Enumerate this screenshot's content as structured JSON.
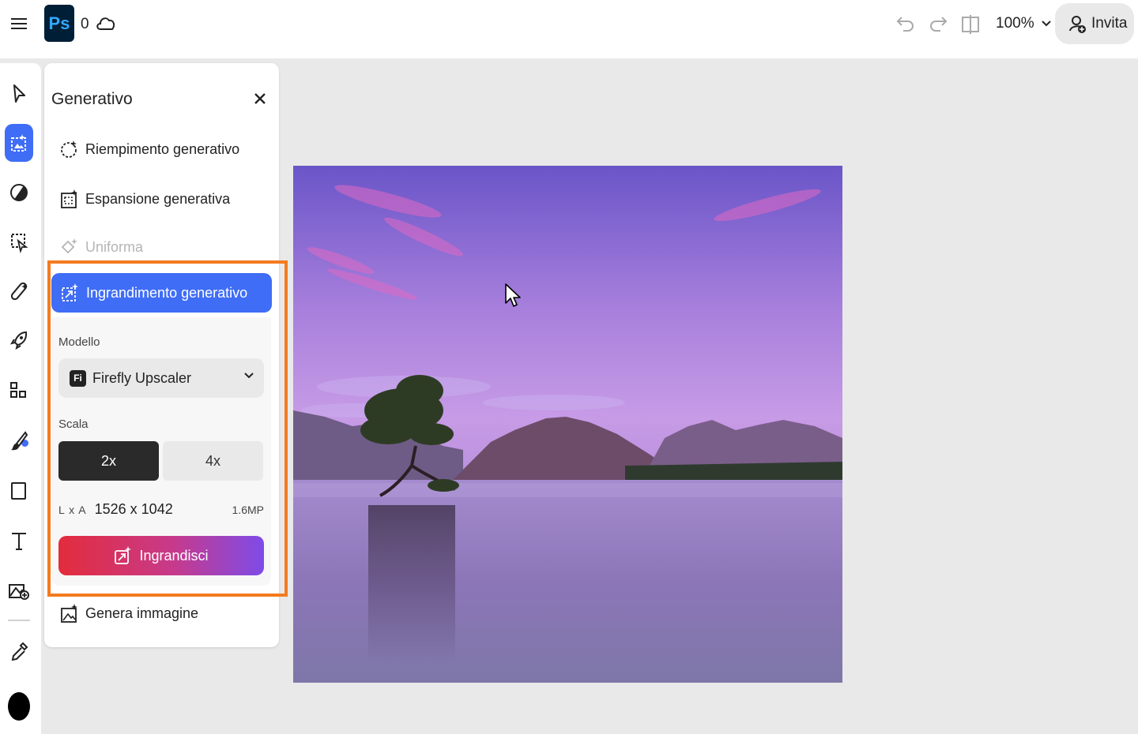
{
  "topbar": {
    "app": "Ps",
    "count": "0",
    "zoom": "100%",
    "invite_label": "Invita"
  },
  "panel": {
    "title": "Generativo",
    "items": [
      {
        "label": "Riempimento generativo",
        "icon": "generative-fill-icon"
      },
      {
        "label": "Espansione generativa",
        "icon": "generative-expand-icon"
      },
      {
        "label": "Uniforma",
        "icon": "harmonize-icon",
        "disabled": true
      },
      {
        "label": "Ingrandimento generativo",
        "icon": "generative-upscale-icon",
        "active": true
      },
      {
        "label": "Genera immagine",
        "icon": "generate-image-icon"
      }
    ],
    "model_label": "Modello",
    "model_badge": "Fi",
    "model_value": "Firefly Upscaler",
    "scale_label": "Scala",
    "scale_options": [
      "2x",
      "4x"
    ],
    "scale_selected": "2x",
    "dims_label": "L x A",
    "dims_value": "1526 x 1042",
    "megapixels": "1.6MP",
    "upscale_button": "Ingrandisci"
  },
  "colors": {
    "accent": "#3f6df6",
    "highlight": "#f47b1f",
    "foreground_color": "#000000"
  }
}
